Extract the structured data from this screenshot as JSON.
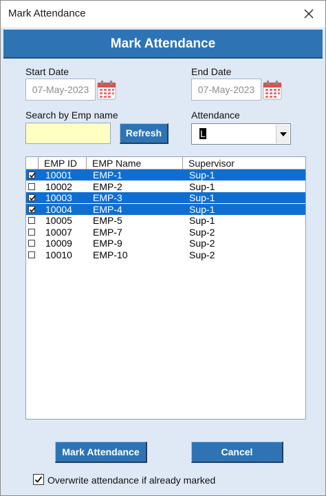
{
  "window": {
    "title": "Mark Attendance"
  },
  "header": {
    "title": "Mark Attendance"
  },
  "start_date": {
    "label": "Start Date",
    "value": "07-May-2023"
  },
  "end_date": {
    "label": "End Date",
    "value": "07-May-2023"
  },
  "search": {
    "label": "Search by Emp name",
    "value": ""
  },
  "refresh_label": "Refresh",
  "attendance": {
    "label": "Attendance",
    "value": "L"
  },
  "table": {
    "columns": [
      "EMP ID",
      "EMP Name",
      "Supervisor"
    ],
    "rows": [
      {
        "id": "10001",
        "name": "EMP-1",
        "supervisor": "Sup-1",
        "checked": true,
        "selected": true
      },
      {
        "id": "10002",
        "name": "EMP-2",
        "supervisor": "Sup-1",
        "checked": false,
        "selected": false
      },
      {
        "id": "10003",
        "name": "EMP-3",
        "supervisor": "Sup-1",
        "checked": true,
        "selected": true
      },
      {
        "id": "10004",
        "name": "EMP-4",
        "supervisor": "Sup-1",
        "checked": true,
        "selected": true
      },
      {
        "id": "10005",
        "name": "EMP-5",
        "supervisor": "Sup-1",
        "checked": false,
        "selected": false
      },
      {
        "id": "10007",
        "name": "EMP-7",
        "supervisor": "Sup-2",
        "checked": false,
        "selected": false
      },
      {
        "id": "10009",
        "name": "EMP-9",
        "supervisor": "Sup-2",
        "checked": false,
        "selected": false
      },
      {
        "id": "10010",
        "name": "EMP-10",
        "supervisor": "Sup-2",
        "checked": false,
        "selected": false
      }
    ]
  },
  "buttons": {
    "mark_label": "Mark Attendance",
    "cancel_label": "Cancel"
  },
  "overwrite": {
    "label": "Overwrite attendance if already marked",
    "checked": true
  },
  "colors": {
    "accent": "#2e74b5",
    "selection": "#0f6fd1",
    "search_bg": "#ffffc4",
    "dialog_bg": "#dfe9f5"
  },
  "icons": {
    "close": "close-icon",
    "calendar": "calendar-icon",
    "dropdown": "chevron-down-icon",
    "check": "checkmark-icon"
  }
}
